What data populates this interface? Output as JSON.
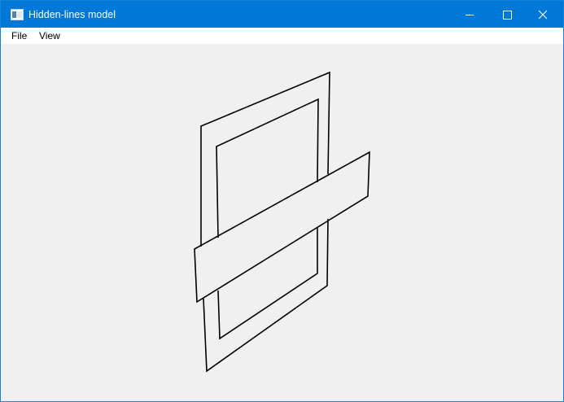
{
  "window": {
    "title": "Hidden-lines model",
    "app_icon": "application-window-icon",
    "caption_buttons": [
      "minimize-icon",
      "maximize-icon",
      "close-icon"
    ],
    "accent_color": "#0078d7"
  },
  "menu": {
    "items": [
      {
        "label": "File"
      },
      {
        "label": "View"
      }
    ]
  },
  "canvas": {
    "background": "#f0f0f0",
    "line_color": "#000000",
    "content": "hidden-lines wireframe model: outer frame, inner frame, and slanted plate crossing in front"
  }
}
